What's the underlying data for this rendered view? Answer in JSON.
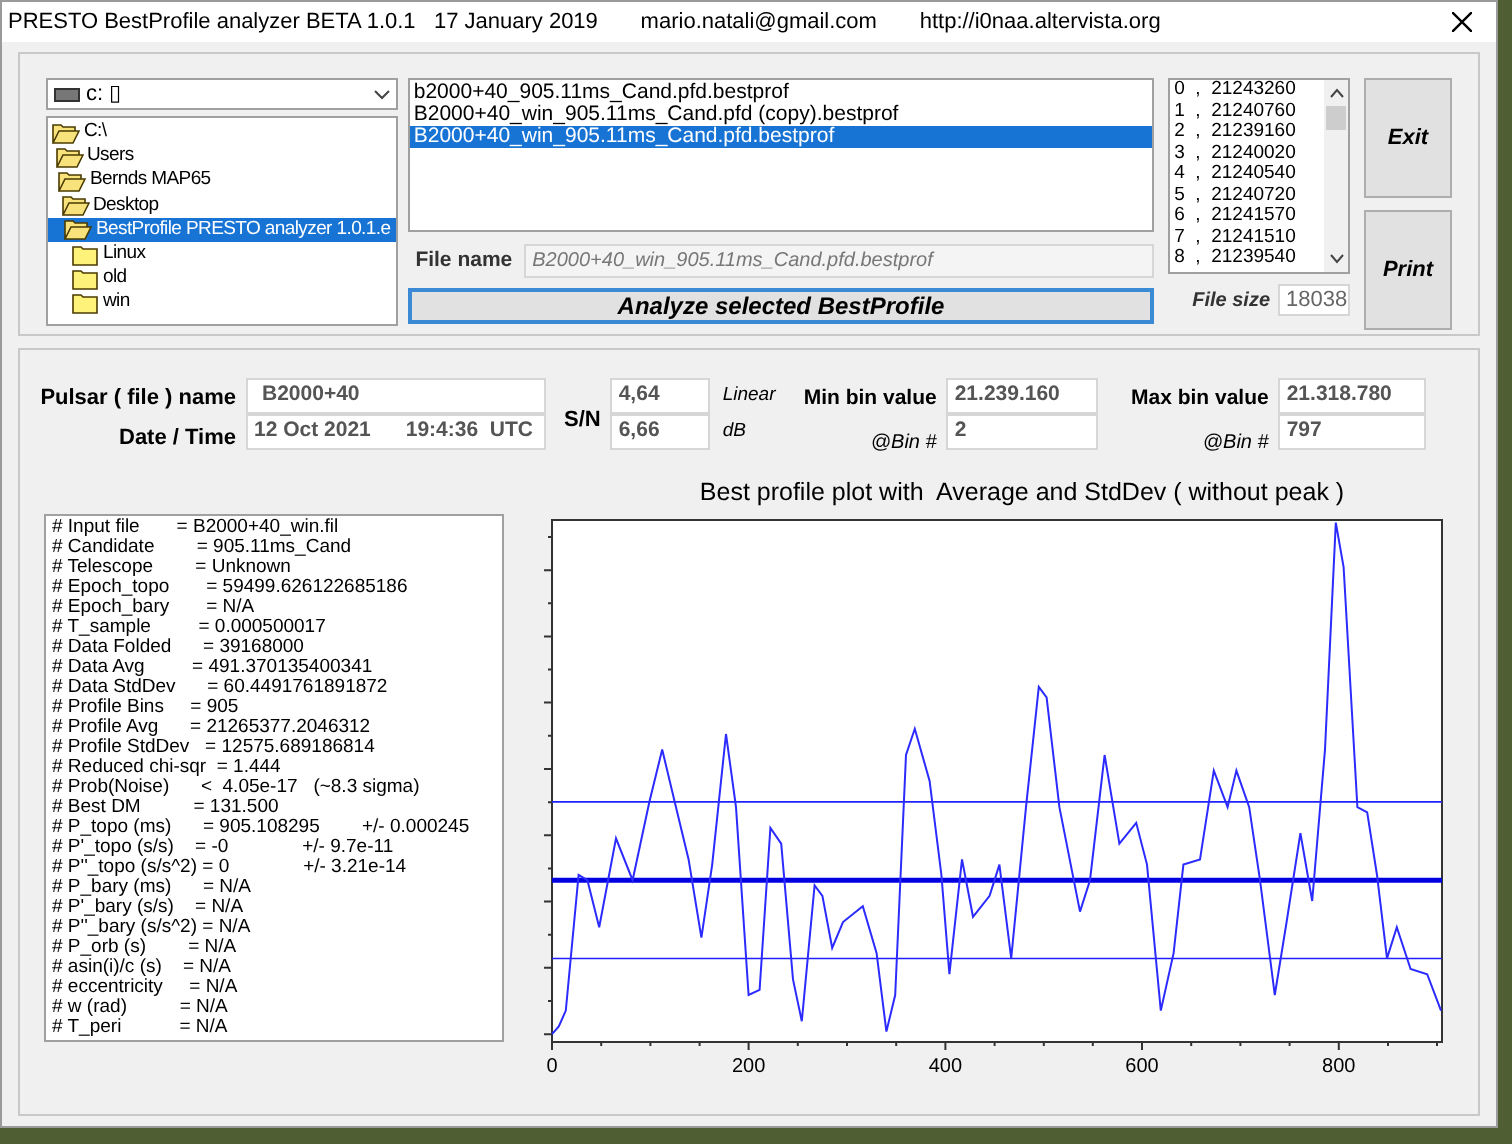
{
  "window": {
    "title": "PRESTO BestProfile analyzer BETA 1.0.1   17 January 2019       mario.natali@gmail.com       http://i0naa.altervista.org"
  },
  "drive": {
    "value": "c: ▯"
  },
  "tree": [
    {
      "label": "C:\\",
      "expanded": true,
      "selected": false,
      "children": [
        {
          "label": "Users",
          "expanded": true,
          "selected": false,
          "children": [
            {
              "label": "Bernds MAP65",
              "expanded": true,
              "selected": false,
              "children": [
                {
                  "label": "Desktop",
                  "expanded": true,
                  "selected": false,
                  "children": [
                    {
                      "label": "BestProfile PRESTO analyzer 1.0.1.e",
                      "expanded": true,
                      "selected": true,
                      "children": [
                        {
                          "label": "Linux",
                          "expanded": false,
                          "selected": false
                        },
                        {
                          "label": "old",
                          "expanded": false,
                          "selected": false
                        },
                        {
                          "label": "win",
                          "expanded": false,
                          "selected": false
                        }
                      ]
                    }
                  ]
                }
              ]
            }
          ]
        }
      ]
    }
  ],
  "files": [
    {
      "label": "b2000+40_905.11ms_Cand.pfd.bestprof",
      "selected": false
    },
    {
      "label": "B2000+40_win_905.11ms_Cand.pfd (copy).bestprof",
      "selected": false
    },
    {
      "label": "B2000+40_win_905.11ms_Cand.pfd.bestprof",
      "selected": true
    }
  ],
  "file_name": {
    "label": "File name",
    "value": "B2000+40_win_905.11ms_Cand.pfd.bestprof"
  },
  "analyze_button": "Analyze selected BestProfile",
  "bins": [
    "0  ,  21243260",
    "1  ,  21240760",
    "2  ,  21239160",
    "3  ,  21240020",
    "4  ,  21240540",
    "5  ,  21240720",
    "6  ,  21241570",
    "7  ,  21241510",
    "8  ,  21239540"
  ],
  "exit_button": "Exit",
  "print_button": "Print",
  "file_size": {
    "label": "File size",
    "value": "18038"
  },
  "pulsar": {
    "label": "Pulsar ( file ) name",
    "value": "B2000+40"
  },
  "date_time": {
    "label": "Date / Time",
    "value": "12 Oct 2021      19:4:36  UTC"
  },
  "sn": {
    "label": "S/N",
    "rows": [
      {
        "value": "4,64",
        "unit": "Linear"
      },
      {
        "value": "6,66",
        "unit": "dB"
      }
    ]
  },
  "min_bin": {
    "label": "Min bin value",
    "value": "21.239.160",
    "bin_label": "@Bin #",
    "bin": "2"
  },
  "max_bin": {
    "label": "Max bin value",
    "value": "21.318.780",
    "bin_label": "@Bin #",
    "bin": "797"
  },
  "report": [
    "# Input file       = B2000+40_win.fil",
    "# Candidate        = 905.11ms_Cand",
    "# Telescope        = Unknown",
    "# Epoch_topo       = 59499.626122685186",
    "# Epoch_bary       = N/A",
    "# T_sample         = 0.000500017",
    "# Data Folded      = 39168000",
    "# Data Avg         = 491.370135400341",
    "# Data StdDev      = 60.4491761891872",
    "# Profile Bins     = 905",
    "# Profile Avg      = 21265377.2046312",
    "# Profile StdDev   = 12575.689186814",
    "# Reduced chi-sqr  = 1.444",
    "# Prob(Noise)      <  4.05e-17   (~8.3 sigma)",
    "# Best DM          = 131.500",
    "# P_topo (ms)      = 905.108295        +/- 0.000245",
    "# P'_topo (s/s)    = -0              +/- 9.7e-11",
    "# P''_topo (s/s^2) = 0              +/- 3.21e-14",
    "# P_bary (ms)      = N/A",
    "# P'_bary (s/s)    = N/A",
    "# P''_bary (s/s^2) = N/A",
    "# P_orb (s)        = N/A",
    "# asin(i)/c (s)    = N/A",
    "# eccentricity     = N/A",
    "# w (rad)          = N/A",
    "# T_peri           = N/A"
  ],
  "chart": {
    "title": "Best profile plot with  Average and StdDev ( without peak )",
    "x_tick_labels": [
      "0",
      "200",
      "400",
      "600",
      "800"
    ]
  }
}
